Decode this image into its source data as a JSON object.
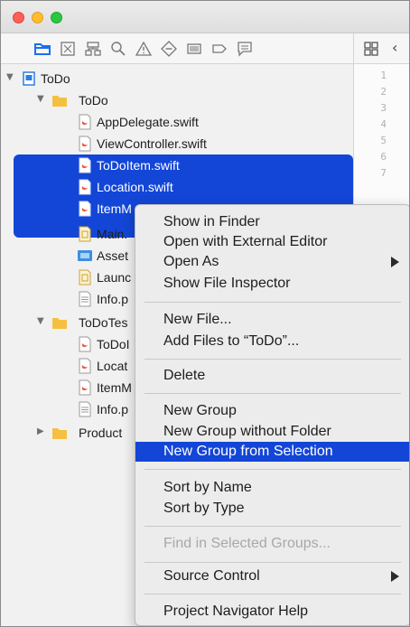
{
  "navigator_icons": [
    "folder-icon",
    "source-control-icon",
    "symbol-icon",
    "find-icon",
    "issue-icon",
    "test-icon",
    "debug-icon",
    "breakpoint-icon",
    "report-icon"
  ],
  "editor": {
    "line_numbers": [
      "1",
      "2",
      "3",
      "4",
      "5",
      "6",
      "7"
    ]
  },
  "tree": {
    "rows": [
      {
        "label": "ToDo",
        "icon": "project-icon",
        "disclosure": "expanded"
      },
      {
        "label": "ToDo",
        "icon": "folder-icon",
        "disclosure": "expanded"
      },
      {
        "label": "AppDelegate.swift",
        "icon": "swift-file-icon"
      },
      {
        "label": "ViewController.swift",
        "icon": "swift-file-icon"
      },
      {
        "label": "ToDoItem.swift",
        "icon": "swift-file-icon",
        "selected": true
      },
      {
        "label": "Location.swift",
        "icon": "swift-file-icon",
        "selected": true
      },
      {
        "label": "ItemM",
        "icon": "swift-file-icon",
        "selected": true
      },
      {
        "label": "Main.",
        "icon": "storyboard-icon"
      },
      {
        "label": "Asset",
        "icon": "asset-catalog-icon"
      },
      {
        "label": "Launc",
        "icon": "storyboard-icon"
      },
      {
        "label": "Info.p",
        "icon": "plist-icon"
      },
      {
        "label": "ToDoTes",
        "icon": "folder-icon",
        "disclosure": "expanded"
      },
      {
        "label": "ToDoI",
        "icon": "swift-file-icon"
      },
      {
        "label": "Locat",
        "icon": "swift-file-icon"
      },
      {
        "label": "ItemM",
        "icon": "swift-file-icon"
      },
      {
        "label": "Info.p",
        "icon": "plist-icon"
      },
      {
        "label": "Product",
        "icon": "folder-icon",
        "disclosure": "collapsed"
      }
    ]
  },
  "context_menu": {
    "items": [
      {
        "label": "Show in Finder"
      },
      {
        "label": "Open with External Editor"
      },
      {
        "label": "Open As",
        "submenu": true
      },
      {
        "label": "Show File Inspector"
      },
      {
        "label": "New File..."
      },
      {
        "label": "Add Files to “ToDo”..."
      },
      {
        "label": "Delete"
      },
      {
        "label": "New Group"
      },
      {
        "label": "New Group without Folder"
      },
      {
        "label": "New Group from Selection",
        "highlighted": true
      },
      {
        "label": "Sort by Name"
      },
      {
        "label": "Sort by Type"
      },
      {
        "label": "Find in Selected Groups...",
        "disabled": true
      },
      {
        "label": "Source Control",
        "submenu": true
      },
      {
        "label": "Project Navigator Help"
      }
    ]
  },
  "colors": {
    "selection": "#1346d7",
    "folder": "#f5c042",
    "swift": "#f05138"
  }
}
